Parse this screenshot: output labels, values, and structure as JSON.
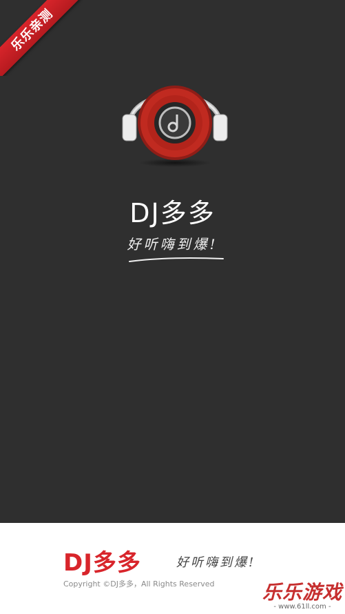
{
  "ribbon": {
    "label": "乐乐亲测",
    "color": "#d8252b"
  },
  "app": {
    "title": "DJ多多",
    "slogan": "好听嗨到爆!",
    "logo_icon": "headphones-vinyl-icon"
  },
  "footer": {
    "brand": "DJ多多",
    "slogan": "好听嗨到爆!",
    "copyright": "Copyright ©DJ多多，All Rights Reserved"
  },
  "watermark": {
    "title": "乐乐游戏",
    "url": "- www.61ll.com -"
  },
  "colors": {
    "background": "#2f2f2f",
    "accent_red": "#d8252b",
    "footer_bg": "#ffffff"
  }
}
